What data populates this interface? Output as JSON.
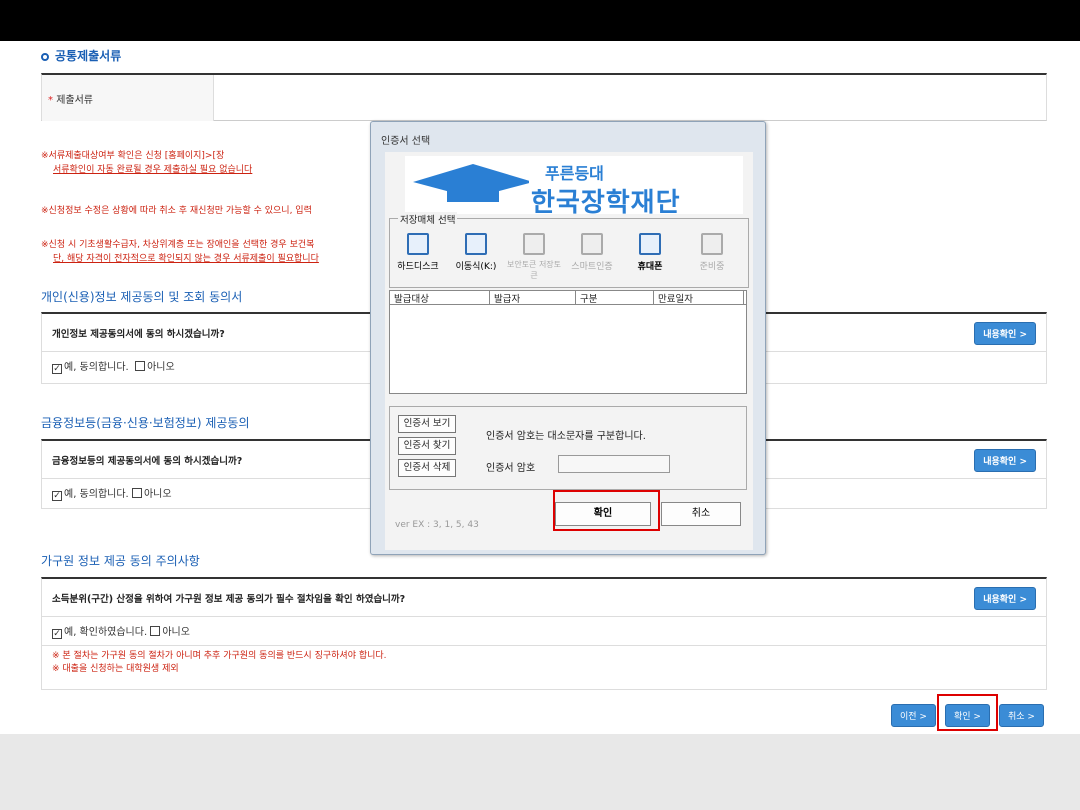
{
  "section_common": {
    "title": "공통제출서류"
  },
  "doc_table": {
    "required_mark": "*",
    "label": "제출서류"
  },
  "notes": [
    {
      "line1": "※서류제출대상여부 확인은 신청",
      "line1_tail": "[홈페이지]>[장",
      "line2": "서류확인이 자동 완료될 경우 제출하실 필요 없습니다"
    },
    {
      "line1": "※신청정보 수정은 상황에 따라 취소 후 재신청만 가능할 수 있으니, 입력"
    },
    {
      "line1": "※신청 시 기초생활수급자, 차상위계층 또는 장애인을 선택한 경우 보건복",
      "line2": "단, 해당 자격이 전자적으로 확인되지 않는 경우 서류제출이 필요합니다"
    }
  ],
  "personal": {
    "title": "개인(신용)정보 제공동의 및 조회 동의서",
    "question": "개인정보 제공동의서에 동의 하시겠습니까?",
    "view_btn": "내용확인 >",
    "yes": "예, 동의합니다.",
    "no": "아니오"
  },
  "finance": {
    "title": "금융정보등(금융·신용·보험정보) 제공동의",
    "question": "금융정보등의 제공동의서에 동의 하시겠습니까?",
    "view_btn": "내용확인 >",
    "yes": "예, 동의합니다.",
    "no": "아니오"
  },
  "household": {
    "title": "가구원 정보 제공 동의 주의사항",
    "question": "소득분위(구간) 산정을 위하여 가구원 정보 제공 동의가 필수 절차임을 확인 하였습니까?",
    "view_btn": "내용확인 >",
    "yes": "예, 확인하였습니다.",
    "no": "아니오",
    "warn1": "※ 본 절차는 가구원 동의 절차가 아니며 추후 가구원의 동의를 반드시 징구하셔야 합니다.",
    "warn2": "※ 대출을 신청하는 대학원생 제외"
  },
  "nav": {
    "prev": "이전 >",
    "confirm": "확인 >",
    "cancel": "취소 >"
  },
  "dialog": {
    "title": "인증서 선택",
    "logo_small": "푸른등대",
    "logo_big": "한국장학재단",
    "storage_legend": "저장매체 선택",
    "media": [
      {
        "label": "하드디스크",
        "icon": "hard-disk-icon",
        "enabled": true
      },
      {
        "label": "이동식(K:)",
        "icon": "removable-disk-icon",
        "enabled": true
      },
      {
        "label": "보안토큰 저장토큰",
        "icon": "security-token-icon",
        "enabled": false
      },
      {
        "label": "스마트인증",
        "icon": "smart-auth-icon",
        "enabled": false
      },
      {
        "label": "휴대폰",
        "icon": "mobile-phone-icon",
        "enabled": true
      },
      {
        "label": "준비중",
        "icon": "preparing-icon",
        "enabled": false
      }
    ],
    "columns": [
      "발급대상",
      "발급자",
      "구분",
      "만료일자"
    ],
    "btn_view": "인증서 보기",
    "btn_find": "인증서 찾기",
    "btn_delete": "인증서 삭제",
    "pw_note": "인증서 암호는 대소문자를 구분합니다.",
    "pw_label": "인증서 암호",
    "ok": "확인",
    "cancel": "취소",
    "version": "ver EX : 3, 1, 5, 43"
  },
  "colors": {
    "accent": "#1a5fb4",
    "button": "#3b8cd6",
    "warning": "#cc2211",
    "highlight": "#dd0000"
  }
}
